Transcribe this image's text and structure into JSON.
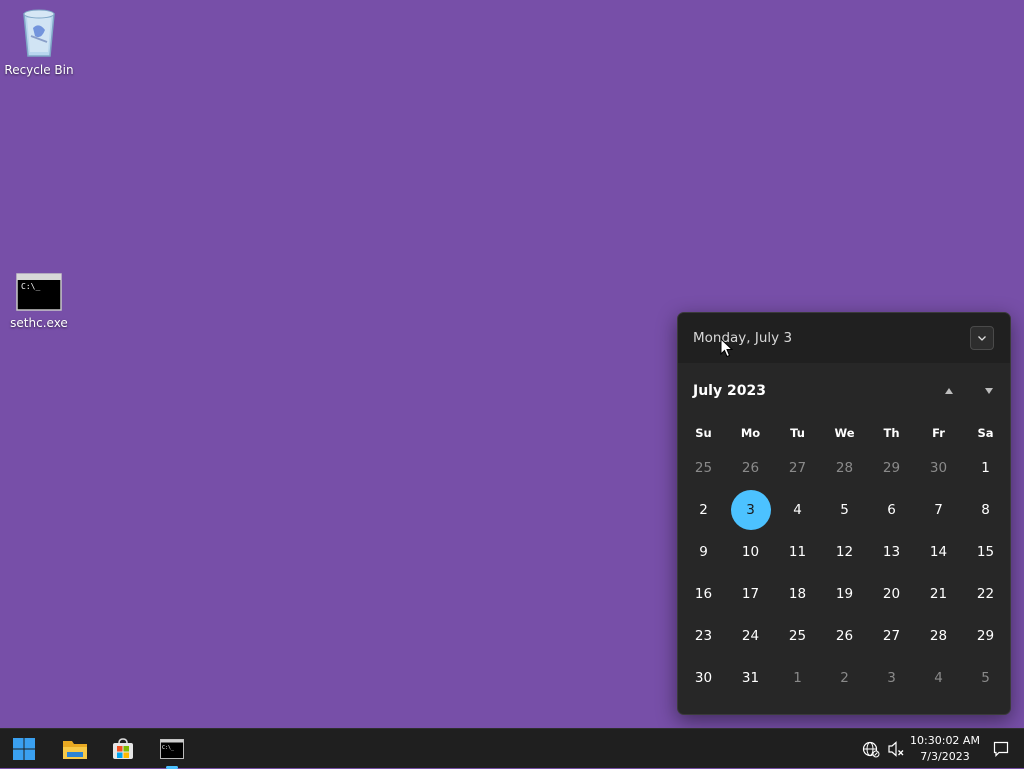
{
  "desktop": {
    "icons": [
      {
        "label": "Recycle Bin",
        "icon": "recycle-bin-icon"
      },
      {
        "label": "sethc.exe",
        "icon": "console-app-icon"
      }
    ]
  },
  "flyout": {
    "date_header": "Monday, July 3",
    "month_label": "July 2023",
    "weekdays": [
      "Su",
      "Mo",
      "Tu",
      "We",
      "Th",
      "Fr",
      "Sa"
    ],
    "today": "3",
    "weeks": [
      [
        "25",
        "26",
        "27",
        "28",
        "29",
        "30",
        "1"
      ],
      [
        "2",
        "3",
        "4",
        "5",
        "6",
        "7",
        "8"
      ],
      [
        "9",
        "10",
        "11",
        "12",
        "13",
        "14",
        "15"
      ],
      [
        "16",
        "17",
        "18",
        "19",
        "20",
        "21",
        "22"
      ],
      [
        "23",
        "24",
        "25",
        "26",
        "27",
        "28",
        "29"
      ],
      [
        "30",
        "31",
        "1",
        "2",
        "3",
        "4",
        "5"
      ]
    ],
    "dim_cells": [
      [
        0,
        0
      ],
      [
        0,
        1
      ],
      [
        0,
        2
      ],
      [
        0,
        3
      ],
      [
        0,
        4
      ],
      [
        0,
        5
      ],
      [
        5,
        2
      ],
      [
        5,
        3
      ],
      [
        5,
        4
      ],
      [
        5,
        5
      ],
      [
        5,
        6
      ]
    ],
    "accent_color": "#4cc2ff"
  },
  "taskbar": {
    "apps": [
      "start-icon",
      "file-explorer-icon",
      "microsoft-store-icon",
      "command-prompt-icon"
    ],
    "active_app": "command-prompt-icon",
    "time": "10:30:02 AM",
    "date": "7/3/2023"
  },
  "colors": {
    "desktop_background": "#774fa8",
    "taskbar": "#1f1f1f",
    "flyout": "#272727"
  }
}
